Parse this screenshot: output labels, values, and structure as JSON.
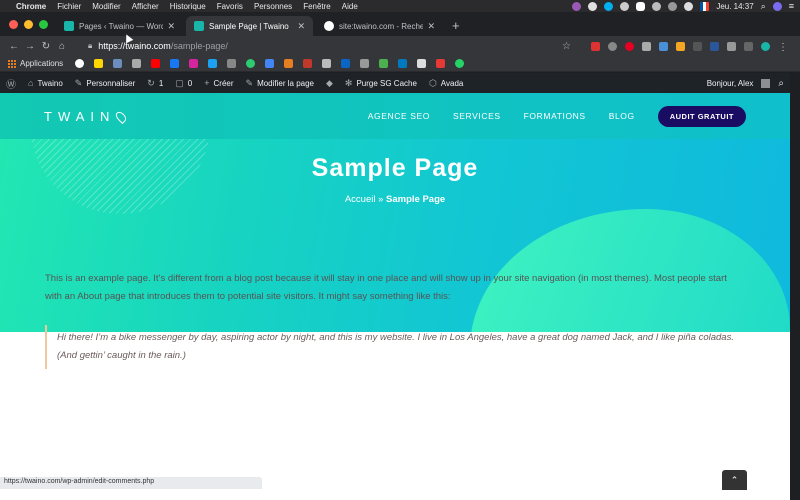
{
  "menubar": {
    "app": "Chrome",
    "items": [
      "Fichier",
      "Modifier",
      "Afficher",
      "Historique",
      "Favoris",
      "Personnes",
      "Fenêtre",
      "Aide"
    ],
    "clock": "Jeu. 14:37"
  },
  "tabs": [
    {
      "title": "Pages ‹ Twaino — WordPress",
      "active": false
    },
    {
      "title": "Sample Page | Twaino",
      "active": true
    },
    {
      "title": "site:twaino.com - Recherche G",
      "active": false
    }
  ],
  "address": {
    "host": "https://twaino.com",
    "path": "/sample-page/"
  },
  "bookmarks": {
    "apps_label": "Applications"
  },
  "wpadmin": {
    "site": "Twaino",
    "customize": "Personnaliser",
    "updates": "1",
    "comments": "0",
    "new": "Créer",
    "edit": "Modifier la page",
    "purge": "Purge SG Cache",
    "avada": "Avada",
    "greeting": "Bonjour, Alex"
  },
  "site": {
    "logo": "TWAIN",
    "nav": [
      "AGENCE SEO",
      "SERVICES",
      "FORMATIONS",
      "BLOG"
    ],
    "cta": "AUDIT GRATUIT",
    "hero_title": "Sample Page",
    "crumb_home": "Accueil",
    "crumb_sep": "»",
    "crumb_current": "Sample Page",
    "paragraph": "This is an example page. It’s different from a blog post because it will stay in one place and will show up in your site navigation (in most themes). Most people start with an About page that introduces them to potential site visitors. It might say something like this:",
    "quote": "Hi there! I’m a bike messenger by day, aspiring actor by night, and this is my website. I live in Los Angeles, have a great dog named Jack, and I like piña coladas. (And gettin’ caught in the rain.)"
  },
  "status_url": "https://twaino.com/wp-admin/edit-comments.php",
  "colors": {
    "accent": "#12c9b2",
    "cta": "#1a0c63",
    "wpbar": "#1d2327"
  }
}
